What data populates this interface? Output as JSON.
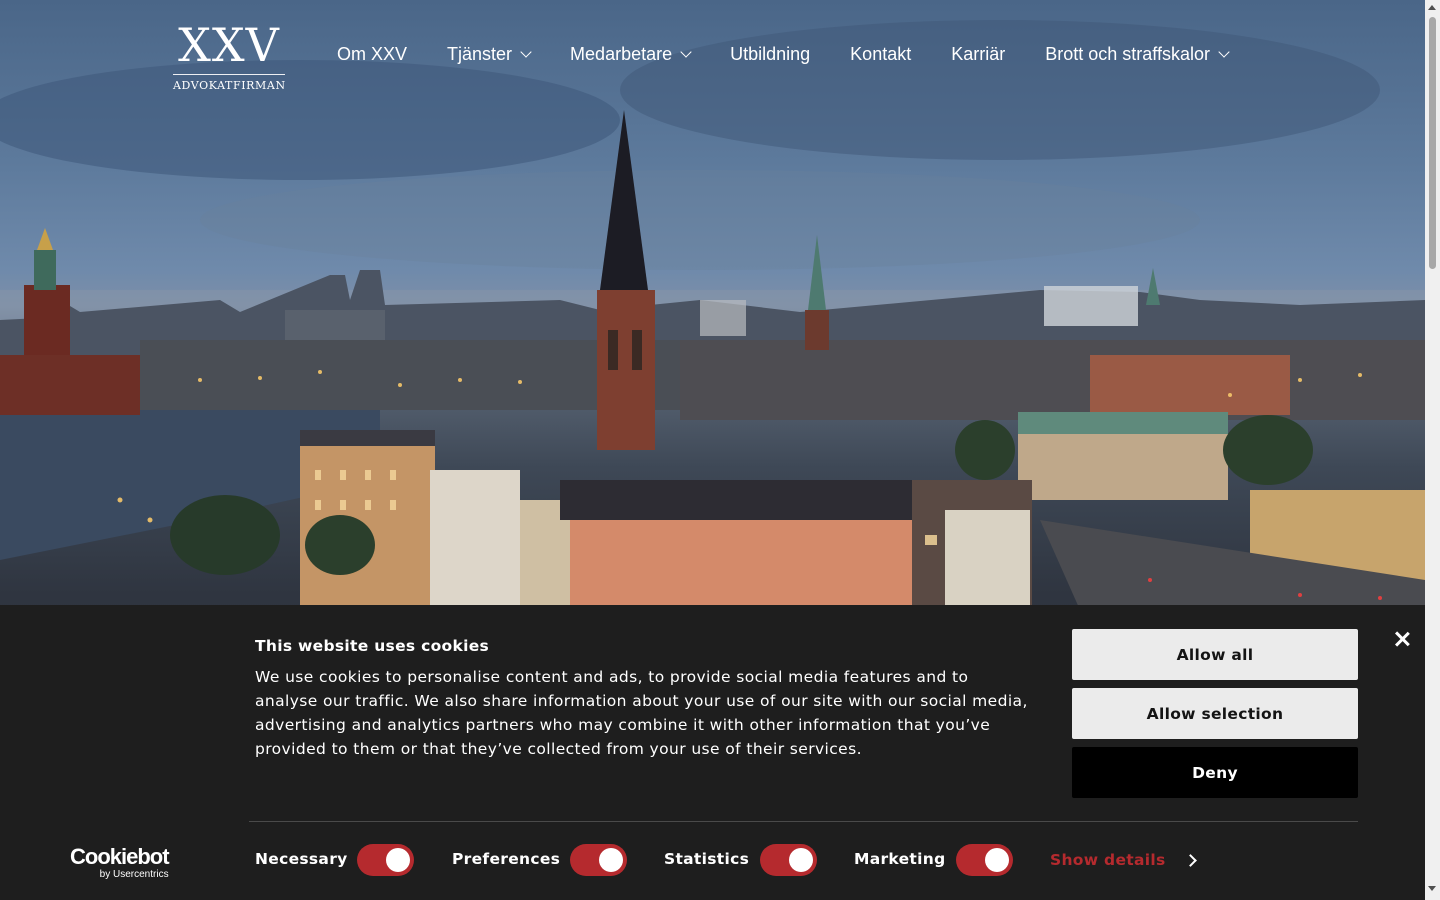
{
  "header": {
    "logo_mark": "XXV",
    "logo_sub": "ADVOKATFIRMAN",
    "nav": [
      {
        "label": "Om XXV",
        "dropdown": false
      },
      {
        "label": "Tjänster",
        "dropdown": true
      },
      {
        "label": "Medarbetare",
        "dropdown": true
      },
      {
        "label": "Utbildning",
        "dropdown": false
      },
      {
        "label": "Kontakt",
        "dropdown": false
      },
      {
        "label": "Karriär",
        "dropdown": false
      },
      {
        "label": "Brott och straffskalor",
        "dropdown": true
      }
    ]
  },
  "hero": {
    "image_icon": "stockholm-skyline-photo"
  },
  "cookie_banner": {
    "title": "This website uses cookies",
    "body": "We use cookies to personalise content and ads, to provide social media features and to analyse our traffic. We also share information about your use of our site with our social media, advertising and analytics partners who may combine it with other information that you’ve provided to them or that they’ve collected from your use of their services.",
    "buttons": {
      "allow_all": "Allow all",
      "allow_selection": "Allow selection",
      "deny": "Deny"
    },
    "toggles": [
      {
        "label": "Necessary",
        "on": true
      },
      {
        "label": "Preferences",
        "on": true
      },
      {
        "label": "Statistics",
        "on": true
      },
      {
        "label": "Marketing",
        "on": true
      }
    ],
    "show_details": "Show details",
    "brand": {
      "name": "Cookiebot",
      "by": "by Usercentrics"
    },
    "colors": {
      "background": "#1e1e1e",
      "toggle_on": "#b52a2e",
      "link": "#b52a2e"
    }
  }
}
